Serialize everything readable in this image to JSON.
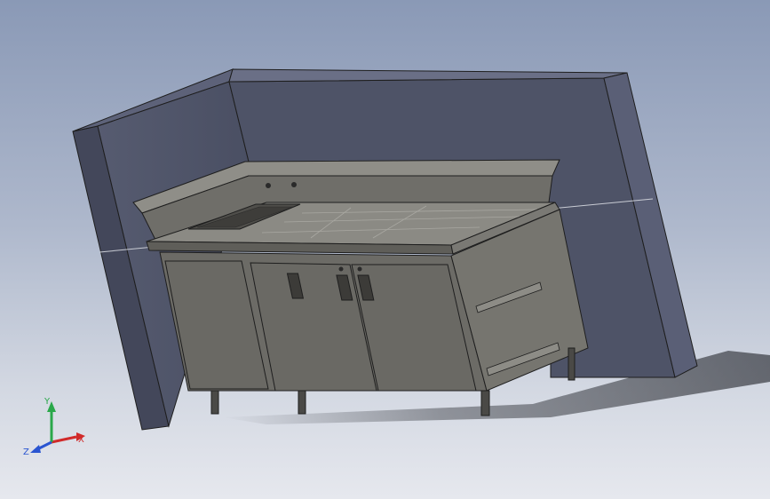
{
  "viewport": {
    "background_top": "#8a99b6",
    "background_bottom": "#e6e8ee"
  },
  "model": {
    "wall_color": "#5a5f74",
    "wall_front_color": "#4f546a",
    "cabinet_color": "#6e6d68",
    "top_color": "#8c8b85",
    "outline_color": "#1e1e1e"
  },
  "triad": {
    "x_label": "X",
    "y_label": "Y",
    "z_label": "Z",
    "x_color": "#d12a2a",
    "y_color": "#2aa84a",
    "z_color": "#2a55d1"
  }
}
